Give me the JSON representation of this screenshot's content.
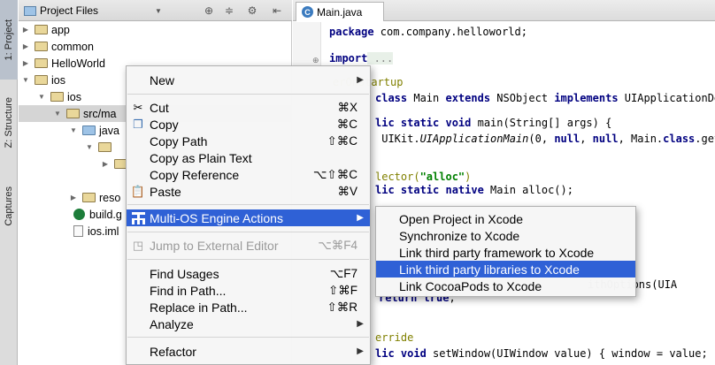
{
  "tool_strip": {
    "project_tab": "1: Project",
    "structure_tab": "Z: Structure",
    "captures_tab": "Captures"
  },
  "project_panel": {
    "title": "Project Files",
    "tree": [
      {
        "label": "app",
        "icon": "folder-icon"
      },
      {
        "label": "common",
        "icon": "folder-icon"
      },
      {
        "label": "HelloWorld",
        "icon": "folder-icon"
      },
      {
        "label": "ios",
        "icon": "folder-icon"
      },
      {
        "label": "ios",
        "icon": "folder-icon"
      },
      {
        "label": "src/ma",
        "icon": "folder-icon"
      },
      {
        "label": "java",
        "icon": "folder-icon"
      },
      {
        "label": "",
        "icon": "folder-icon"
      },
      {
        "label": "",
        "icon": "folder-icon"
      },
      {
        "label": "reso",
        "icon": "folder-icon"
      },
      {
        "label": "build.g",
        "icon": "gradle-icon"
      },
      {
        "label": "ios.iml",
        "icon": "file-icon"
      }
    ]
  },
  "editor": {
    "tab_label": "Main.java",
    "lines": {
      "l1a": "package",
      "l1b": " com.company.helloworld;",
      "l2a": "import",
      "l2b": " ...",
      "l3": "erOnStartup",
      "l4a": "class",
      "l4b": " Main ",
      "l4c": "extends",
      "l4d": " NSObject ",
      "l4e": "implements",
      "l4f": " UIApplicationDel",
      "l5a": "lic static void",
      "l5b": " main(String[] args) {",
      "l6a": " UIKit.",
      "l6b": "UIApplicationMain",
      "l6c": "(0, ",
      "l6d": "null",
      "l6e": ", ",
      "l6f": "null",
      "l6g": ", Main.",
      "l6h": "class",
      "l6i": ".getN",
      "l7a": "lector(",
      "l7b": "\"alloc\"",
      "l7c": ")",
      "l8a": "lic static native",
      "l8b": " Main alloc();",
      "l9": "ithOptions(UIA",
      "l10a": "return",
      "l10b": " true",
      "l11": "erride",
      "l12a": "lic void",
      "l12b": " setWindow(UIWindow value) { window = value; }"
    }
  },
  "context_menu": {
    "items": [
      {
        "label": "New",
        "shortcut": "",
        "submenu": true
      },
      {
        "label": "Cut",
        "shortcut": "⌘X"
      },
      {
        "label": "Copy",
        "shortcut": "⌘C"
      },
      {
        "label": "Copy Path",
        "shortcut": "⇧⌘C"
      },
      {
        "label": "Copy as Plain Text",
        "shortcut": ""
      },
      {
        "label": "Copy Reference",
        "shortcut": "⌥⇧⌘C"
      },
      {
        "label": "Paste",
        "shortcut": "⌘V"
      },
      {
        "label": "Multi-OS Engine Actions",
        "shortcut": "",
        "submenu": true
      },
      {
        "label": "Jump to External Editor",
        "shortcut": "⌥⌘F4"
      },
      {
        "label": "Find Usages",
        "shortcut": "⌥F7"
      },
      {
        "label": "Find in Path...",
        "shortcut": "⇧⌘F"
      },
      {
        "label": "Replace in Path...",
        "shortcut": "⇧⌘R"
      },
      {
        "label": "Analyze",
        "shortcut": "",
        "submenu": true
      },
      {
        "label": "Refactor",
        "shortcut": "",
        "submenu": true
      }
    ]
  },
  "submenu": {
    "items": [
      "Open Project in Xcode",
      "Synchronize to Xcode",
      "Link third party framework to Xcode",
      "Link third party libraries to Xcode",
      "Link CocoaPods to Xcode"
    ]
  },
  "colors": {
    "highlight": "#2f61d6",
    "keyword": "#000080",
    "string": "#008000",
    "annotation": "#808000"
  }
}
